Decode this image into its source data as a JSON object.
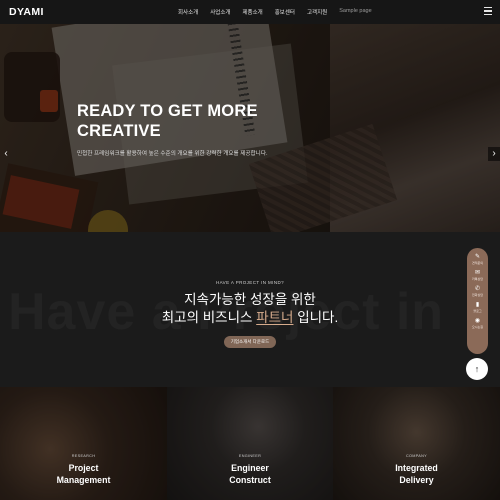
{
  "header": {
    "logo": "DYAMI",
    "nav": [
      "회사소개",
      "사업소개",
      "제품소개",
      "홍보센터",
      "고객지원",
      "Sample page"
    ]
  },
  "hero": {
    "title": "READY TO GET MORE\nCREATIVE",
    "subtitle": "민첩한 프레임워크를 활용하여 높은 수준의 개요를 위한 강력한 개요를 제공합니다.",
    "prev_arrow": "‹",
    "next_arrow": "›"
  },
  "project": {
    "background_text": "Have a Project in",
    "eyebrow": "HAVE A PROJECT IN MIND?",
    "headline_line1": "지속가능한 성장을 위한",
    "headline_line2_pre": "최고의 비즈니스 ",
    "headline_highlight": "파트너",
    "headline_line2_post": " 입니다.",
    "cta_label": "기업소개서 다운로드"
  },
  "quick_menu": [
    {
      "icon": "✎",
      "label": "견적문의"
    },
    {
      "icon": "✉",
      "label": "카톡상담"
    },
    {
      "icon": "✆",
      "label": "전화상담"
    },
    {
      "icon": "▮",
      "label": "블로그"
    },
    {
      "icon": "◉",
      "label": "오시는길"
    }
  ],
  "top_button": "↑",
  "tiles": [
    {
      "kicker": "RESEARCH",
      "name": "Project\nManagement"
    },
    {
      "kicker": "ENGINEER",
      "name": "Engineer\nConstruct"
    },
    {
      "kicker": "COMPANY",
      "name": "Integrated\nDelivery"
    }
  ],
  "colors": {
    "accent": "#d6ab8c",
    "button": "#806656",
    "quick_menu": "#8b6a58",
    "section_bg": "#1b1b1b"
  }
}
